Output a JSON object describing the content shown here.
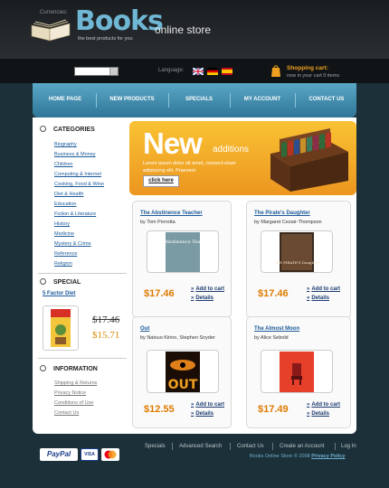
{
  "header": {
    "logo_title": "Books",
    "logo_subtitle": "online store",
    "tagline": "the best products for you"
  },
  "toolbar": {
    "currencies_label": "Currencies:",
    "language_label": "Language:",
    "cart_title": "Shopping cart:",
    "cart_status": "now in your cart 0 items"
  },
  "nav": {
    "items": [
      {
        "label": "HOME PAGE"
      },
      {
        "label": "NEW PRODUCTS"
      },
      {
        "label": "SPECIALS"
      },
      {
        "label": "MY ACCOUNT"
      },
      {
        "label": "CONTACT US"
      }
    ]
  },
  "sidebar": {
    "categories_title": "CATEGORIES",
    "categories": [
      "Biography",
      "Business & Money",
      "Children",
      "Computing & Internet",
      "Cooking, Food & Wine",
      "Diet & Health",
      "Education",
      "Fiction & Literature",
      "History",
      "Medicine",
      "Mystery & Crime",
      "Reference",
      "Religion"
    ],
    "special_title": "SPECIAL",
    "special_product": "5 Factor Diet",
    "special_old_price": "$17.46",
    "special_new_price": "$15.71",
    "info_title": "INFORMATION",
    "info_links": [
      "Shipping & Returns",
      "Privacy Notice",
      "Conditions of Use",
      "Contact Us"
    ]
  },
  "banner": {
    "big": "New",
    "small": "additions",
    "text": "Lorem ipsum dolor sit amet, consect-etuer adipiscing elit. Praesent",
    "button": "click here"
  },
  "products": [
    {
      "title": "The Abstinence Teacher",
      "author": "by Tom Perrotta",
      "price": "$17.46",
      "cover_text": "The Abstinence Teacher"
    },
    {
      "title": "The Pirate's Daughter",
      "author": "by Margaret Cezair-Thompson",
      "price": "$17.46",
      "cover_text": "THE PIRATE'S Daughter"
    },
    {
      "title": "Out",
      "author": "by Natsuo Kirino, Stephen Snyder",
      "price": "$12.55",
      "cover_text": "OUT"
    },
    {
      "title": "The Almost Moon",
      "author": "by Alice Sebold",
      "price": "$17.49",
      "cover_text": ""
    }
  ],
  "product_actions": {
    "add_to_cart": "Add to cart",
    "details": "Details"
  },
  "footer": {
    "links": [
      "Specials",
      "Advanced Search",
      "Contact Us",
      "Create an Account",
      "Log In"
    ],
    "copyright": "Books Online Store © 2008",
    "privacy": "Privacy Policy",
    "payment_paypal": "PayPal",
    "payment_visa": "VISA"
  }
}
